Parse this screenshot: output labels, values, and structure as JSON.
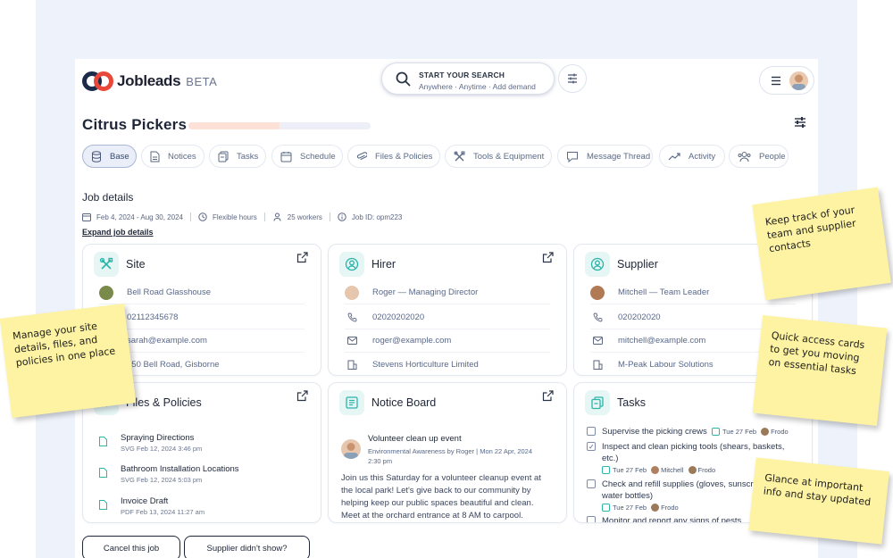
{
  "app": {
    "brand": "Jobleads",
    "brand_badge": "BETA",
    "search_title": "START YOUR SEARCH",
    "search_subtitle": "Anywhere · Anytime · Add demand"
  },
  "job": {
    "title": "Citrus Pickers",
    "progress_fraction": 0.5,
    "section_title": "Job details",
    "dates": "Feb 4, 2024 - Aug 30, 2024",
    "hours": "Flexible hours",
    "workers": "25 workers",
    "job_id": "Job ID: opm223",
    "expand_label": "Expand job details"
  },
  "tabs": [
    {
      "label": "Base",
      "icon": "database-icon"
    },
    {
      "label": "Notices",
      "icon": "document-icon"
    },
    {
      "label": "Tasks",
      "icon": "clipboard-icon"
    },
    {
      "label": "Schedule",
      "icon": "calendar-icon"
    },
    {
      "label": "Files & Policies",
      "icon": "paperclip-icon"
    },
    {
      "label": "Tools & Equipment",
      "icon": "tools-icon"
    },
    {
      "label": "Message Thread",
      "icon": "chat-icon"
    },
    {
      "label": "Activity",
      "icon": "trend-icon"
    },
    {
      "label": "People",
      "icon": "people-icon"
    }
  ],
  "site": {
    "title": "Site",
    "name": "Bell Road Glasshouse",
    "phone": "02112345678",
    "email": "sarah@example.com",
    "address": "150 Bell Road, Gisborne"
  },
  "hirer": {
    "title": "Hirer",
    "name": "Roger — Managing Director",
    "phone": "02020202020",
    "email": "roger@example.com",
    "company": "Stevens Horticulture Limited"
  },
  "supplier": {
    "title": "Supplier",
    "name": "Mitchell — Team Leader",
    "phone": "020202020",
    "email": "mitchell@example.com",
    "company": "M-Peak Labour Solutions"
  },
  "files": {
    "title": "Files & Policies",
    "items": [
      {
        "name": "Spraying Directions",
        "meta": "SVG Feb 12, 2024 3:46 pm"
      },
      {
        "name": "Bathroom Installation Locations",
        "meta": "SVG Feb 12, 2024 5:03 pm"
      },
      {
        "name": "Invoice Draft",
        "meta": "PDF Feb 13, 2024 11:27 am"
      }
    ]
  },
  "notice": {
    "title": "Notice Board",
    "heading": "Volunteer clean up event",
    "meta": "Environmental Awareness by Roger | Mon 22 Apr, 2024 2:30 pm",
    "body": "Join us this Saturday for a volunteer cleanup event at the local park! Let's give back to our community by helping keep our public spaces beautiful and clean. Meet at the orchard entrance at 8 AM to carpool."
  },
  "tasks": {
    "title": "Tasks",
    "items": [
      {
        "text": "Supervise the picking crews",
        "date": "Tue 27 Feb",
        "people": [
          "Frodo"
        ],
        "checked": false
      },
      {
        "text": "Inspect and clean picking tools (shears, baskets, etc.)",
        "date": "Tue 27 Feb",
        "people": [
          "Mitchell",
          "Frodo"
        ],
        "checked": true
      },
      {
        "text": "Check and refill supplies (gloves, sunscreen, water bottles)",
        "date": "Tue 27 Feb",
        "people": [
          "Frodo"
        ],
        "checked": false
      },
      {
        "text": "Monitor and report any signs of pests",
        "checked": false
      }
    ]
  },
  "buttons": {
    "cancel": "Cancel this job",
    "no_show": "Supplier didn't show?"
  },
  "stickies": {
    "contacts": "Keep track of your team and supplier contacts",
    "site": "Manage your site details, files, and policies in one place",
    "quick": "Quick access cards to get you moving on essential tasks",
    "glance": "Glance at important info and stay updated"
  },
  "colors": {
    "accent_teal": "#2bb4a8",
    "logo_red": "#e8473a",
    "logo_navy": "#1c2b4a",
    "sticky": "#fdf3a2"
  }
}
